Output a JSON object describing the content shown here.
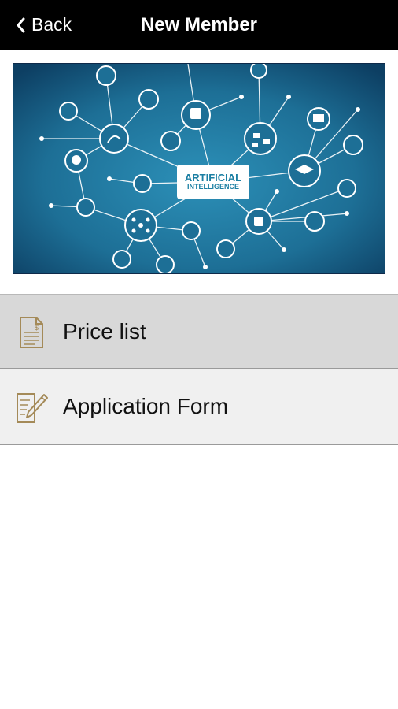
{
  "navbar": {
    "back_label": "Back",
    "title": "New Member",
    "back_icon": "chevron-left-icon"
  },
  "banner": {
    "line1": "ARTIFICIAL",
    "line2": "INTELLIGENCE",
    "background_color": "#1d6f96"
  },
  "menu": {
    "items": [
      {
        "label": "Price list",
        "icon": "price-document-icon"
      },
      {
        "label": "Application Form",
        "icon": "edit-form-icon"
      }
    ],
    "icon_color": "#a48a58"
  }
}
